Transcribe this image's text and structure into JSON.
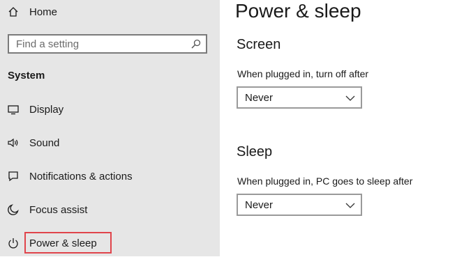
{
  "sidebar": {
    "home": {
      "label": "Home",
      "icon": "home-icon"
    },
    "search": {
      "placeholder": "Find a setting",
      "icon": "search-icon"
    },
    "section_heading": "System",
    "items": [
      {
        "label": "Display",
        "icon": "display-icon"
      },
      {
        "label": "Sound",
        "icon": "speaker-icon"
      },
      {
        "label": "Notifications & actions",
        "icon": "notification-icon"
      },
      {
        "label": "Focus assist",
        "icon": "moon-icon"
      },
      {
        "label": "Power & sleep",
        "icon": "power-icon",
        "highlighted": true
      }
    ],
    "highlight_color": "#e0444b"
  },
  "main": {
    "title": "Power & sleep",
    "screen": {
      "heading": "Screen",
      "label": "When plugged in, turn off after",
      "value": "Never"
    },
    "sleep": {
      "heading": "Sleep",
      "label": "When plugged in, PC goes to sleep after",
      "value": "Never"
    }
  }
}
